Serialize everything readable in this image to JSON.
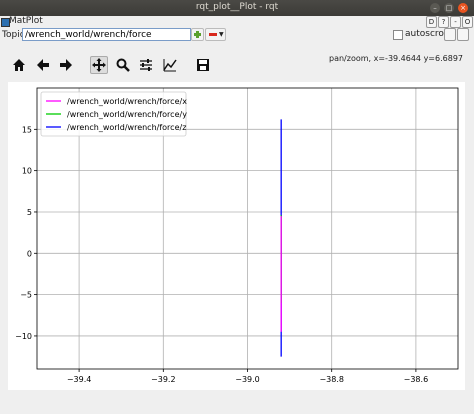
{
  "window": {
    "title": "rqt_plot__Plot - rqt",
    "plugin_name": "MatPlot",
    "plugin_buttons": [
      "D",
      "?",
      "-",
      "O"
    ]
  },
  "topic": {
    "label": "Topic",
    "value": "/wrench_world/wrench/force",
    "autoscroll_label": "autoscroll",
    "autoscroll_checked": false
  },
  "toolbar": {
    "icons": [
      "home-icon",
      "back-arrow-icon",
      "forward-arrow-icon",
      "pan-icon",
      "zoom-icon",
      "configure-subplots-icon",
      "edit-curves-icon",
      "save-icon"
    ],
    "status": "pan/zoom, x=-39.4644     y=6.6897"
  },
  "chart_data": {
    "type": "line",
    "title": "",
    "xlabel": "",
    "ylabel": "",
    "xlim": [
      -39.5,
      -38.5
    ],
    "ylim": [
      -14,
      20
    ],
    "xticks": [
      -39.4,
      -39.2,
      -39.0,
      -38.8,
      -38.6
    ],
    "xtick_labels": [
      "−39.4",
      "−39.2",
      "−39.0",
      "−38.8",
      "−38.6"
    ],
    "yticks": [
      -10,
      -5,
      0,
      5,
      10,
      15
    ],
    "ytick_labels": [
      "−10",
      "−5",
      "0",
      "5",
      "10",
      "15"
    ],
    "grid": true,
    "legend_position": "top-left",
    "series": [
      {
        "name": "/wrench_world/wrench/force/x",
        "color": "#ff00ff",
        "x": [
          -38.92,
          -38.92
        ],
        "y": [
          -9.5,
          4.5
        ]
      },
      {
        "name": "/wrench_world/wrench/force/y",
        "color": "#00cc00",
        "x": [
          -38.92,
          -38.92
        ],
        "y": [
          -6.0,
          4.6
        ]
      },
      {
        "name": "/wrench_world/wrench/force/z",
        "color": "#0000ff",
        "x": [
          -38.92,
          -38.92
        ],
        "y": [
          -12.5,
          16.2
        ]
      }
    ]
  }
}
